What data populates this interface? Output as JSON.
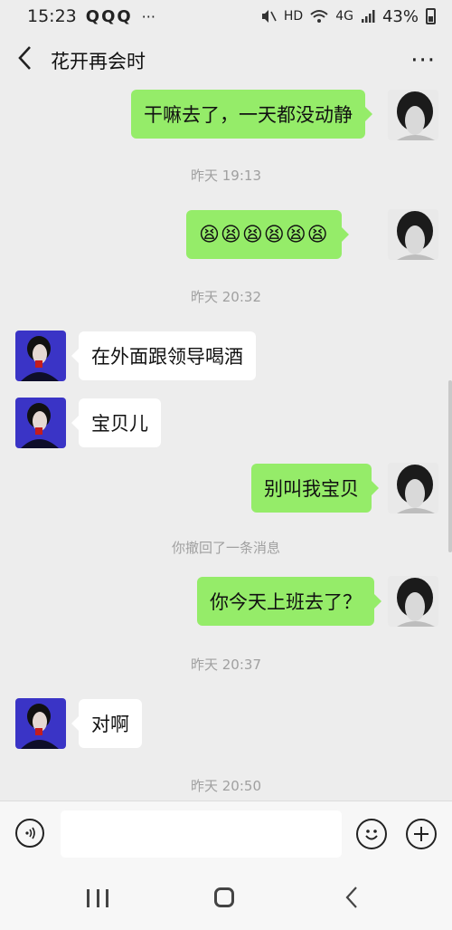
{
  "status": {
    "time": "15:23",
    "notif_icons": "QQQ",
    "more_dots": "···",
    "network": "HD",
    "signal": "4G",
    "battery": "43%"
  },
  "header": {
    "title": "花开再会时",
    "more": "···"
  },
  "messages": [
    {
      "side": "me",
      "text": "干嘛去了，一天都没动静"
    },
    {
      "type": "time",
      "text": "昨天 19:13"
    },
    {
      "side": "me",
      "text": "😫😫😫😫😫😫"
    },
    {
      "type": "time",
      "text": "昨天 20:32"
    },
    {
      "side": "other",
      "text": "在外面跟领导喝酒"
    },
    {
      "side": "other",
      "text": "宝贝儿"
    },
    {
      "side": "me",
      "text": "别叫我宝贝"
    },
    {
      "type": "system",
      "text": "你撤回了一条消息"
    },
    {
      "side": "me",
      "text": "你今天上班去了？"
    },
    {
      "type": "time",
      "text": "昨天 20:37"
    },
    {
      "side": "other",
      "text": "对啊"
    },
    {
      "type": "time",
      "text": "昨天 20:50"
    }
  ],
  "input": {
    "placeholder": ""
  },
  "icons": {
    "voice": "voice-icon",
    "emoji": "emoji-icon",
    "plus": "plus-icon"
  },
  "colors": {
    "bg": "#ededed",
    "my_bubble": "#95ec69",
    "their_bubble": "#ffffff",
    "their_avatar": "#3a34c6"
  }
}
